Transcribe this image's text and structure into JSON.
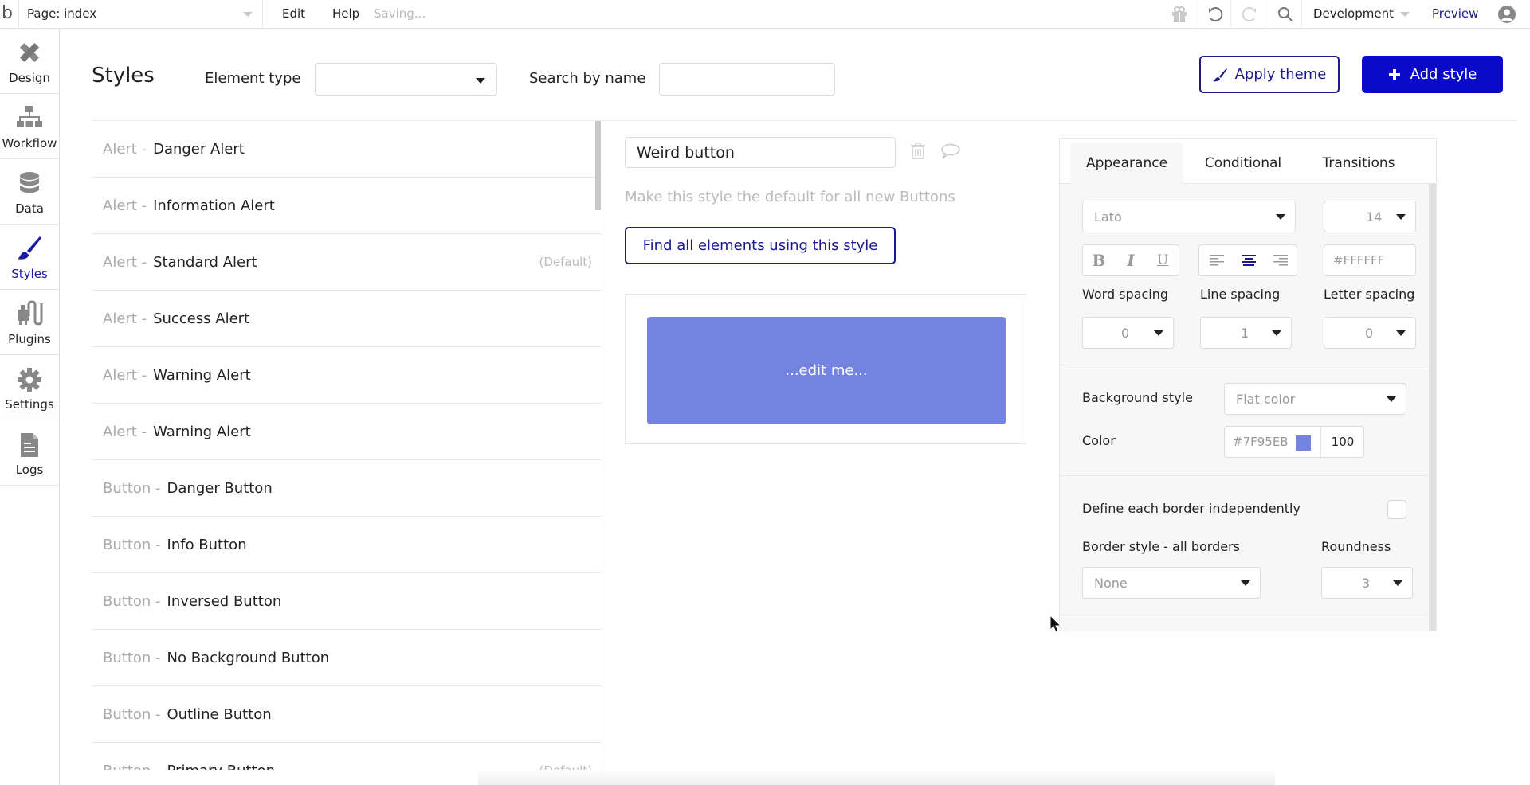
{
  "topbar": {
    "logo": "b",
    "page_selector": "Page: index",
    "menu": [
      "Edit",
      "Help"
    ],
    "status": "Saving...",
    "icons": [
      "gift-icon",
      "undo-icon",
      "redo-icon",
      "search-icon"
    ],
    "environment": "Development",
    "preview_label": "Preview",
    "account_icon": "user-avatar-icon"
  },
  "sidebar": {
    "items": [
      {
        "label": "Design",
        "icon": "design-icon",
        "active": false
      },
      {
        "label": "Workflow",
        "icon": "workflow-icon",
        "active": false
      },
      {
        "label": "Data",
        "icon": "database-icon",
        "active": false
      },
      {
        "label": "Styles",
        "icon": "paintbrush-icon",
        "active": true
      },
      {
        "label": "Plugins",
        "icon": "plugin-icon",
        "active": false
      },
      {
        "label": "Settings",
        "icon": "gear-icon",
        "active": false
      },
      {
        "label": "Logs",
        "icon": "document-icon",
        "active": false
      }
    ]
  },
  "header": {
    "title": "Styles",
    "element_type_label": "Element type",
    "element_type_value": "",
    "search_label": "Search by name",
    "search_value": "",
    "apply_theme_label": "Apply theme",
    "add_style_label": "Add style"
  },
  "style_list": [
    {
      "type": "Alert -",
      "name": "Danger Alert",
      "default": ""
    },
    {
      "type": "Alert -",
      "name": "Information Alert",
      "default": ""
    },
    {
      "type": "Alert -",
      "name": "Standard Alert",
      "default": "(Default)"
    },
    {
      "type": "Alert -",
      "name": "Success Alert",
      "default": ""
    },
    {
      "type": "Alert -",
      "name": "Warning Alert",
      "default": ""
    },
    {
      "type": "Alert -",
      "name": "Warning Alert",
      "default": ""
    },
    {
      "type": "Button -",
      "name": "Danger Button",
      "default": ""
    },
    {
      "type": "Button -",
      "name": "Info Button",
      "default": ""
    },
    {
      "type": "Button -",
      "name": "Inversed Button",
      "default": ""
    },
    {
      "type": "Button -",
      "name": "No Background Button",
      "default": ""
    },
    {
      "type": "Button -",
      "name": "Outline Button",
      "default": ""
    },
    {
      "type": "Button -",
      "name": "Primary Button",
      "default": "(Default)"
    }
  ],
  "editor": {
    "style_name": "Weird button",
    "make_default_label": "Make this style the default for all new Buttons",
    "find_all_label": "Find all elements using this style",
    "preview_text": "...edit me...",
    "preview_bg_color": "#7F95EB",
    "preview_text_color": "#FFFFFF"
  },
  "properties": {
    "tabs": [
      {
        "label": "Appearance",
        "active": true
      },
      {
        "label": "Conditional",
        "active": false
      },
      {
        "label": "Transitions",
        "active": false
      }
    ],
    "font_family": "Lato",
    "font_size": "14",
    "format_buttons": [
      "B",
      "I",
      "U"
    ],
    "alignment": {
      "options": [
        "left",
        "center",
        "right"
      ],
      "selected": "center"
    },
    "font_color": "#FFFFFF",
    "word_spacing_label": "Word spacing",
    "word_spacing": "0",
    "line_spacing_label": "Line spacing",
    "line_spacing": "1",
    "letter_spacing_label": "Letter spacing",
    "letter_spacing": "0",
    "background_style_label": "Background style",
    "background_style": "Flat color",
    "color_label": "Color",
    "color_hex": "#7F95EB",
    "color_opacity": "100",
    "border_independent_label": "Define each border independently",
    "border_independent_checked": false,
    "border_style_label": "Border style - all borders",
    "border_style": "None",
    "roundness_label": "Roundness",
    "roundness": "3"
  },
  "colors": {
    "accent": "#1A1A8C",
    "primary_button": "#0A0AC8",
    "preview_swatch": "#7F95EB"
  }
}
